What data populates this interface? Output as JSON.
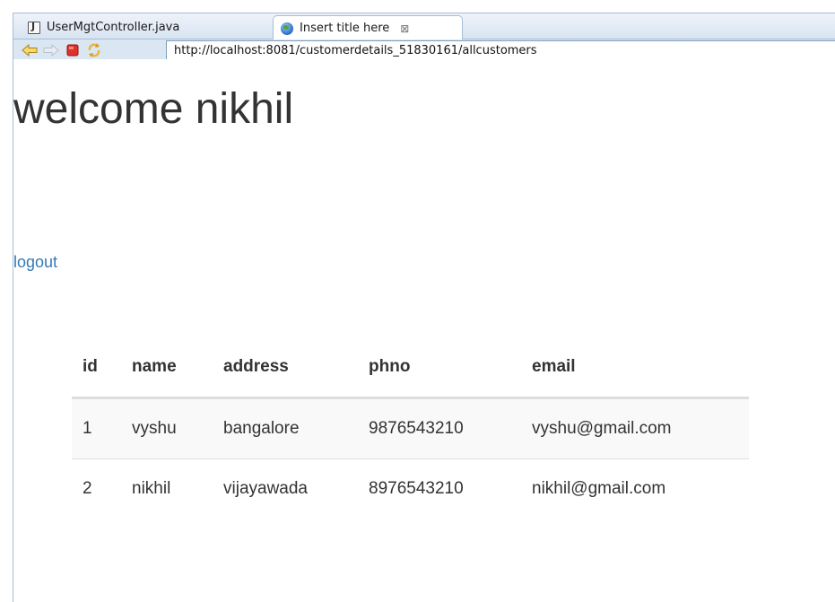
{
  "tabs": [
    {
      "label": "UserMgtController.java",
      "icon": "java-file-icon",
      "active": false
    },
    {
      "label": "Insert title here",
      "icon": "globe-icon",
      "active": true,
      "close": "⊠"
    }
  ],
  "navigation": {
    "url": "http://localhost:8081/customerdetails_51830161/allcustomers",
    "back_icon": "back-arrow-icon",
    "forward_icon": "forward-arrow-icon",
    "stop_icon": "stop-icon",
    "refresh_icon": "refresh-icon"
  },
  "page": {
    "title": "welcome nikhil",
    "logout_label": "logout"
  },
  "table": {
    "headers": [
      "id",
      "name",
      "address",
      "phno",
      "email"
    ],
    "rows": [
      [
        "1",
        "vyshu",
        "bangalore",
        "9876543210",
        "vyshu@gmail.com"
      ],
      [
        "2",
        "nikhil",
        "vijayawada",
        "8976543210",
        "nikhil@gmail.com"
      ]
    ]
  },
  "colors": {
    "link": "#337ab7",
    "text": "#333333",
    "chrome": "#d3e1f1"
  }
}
